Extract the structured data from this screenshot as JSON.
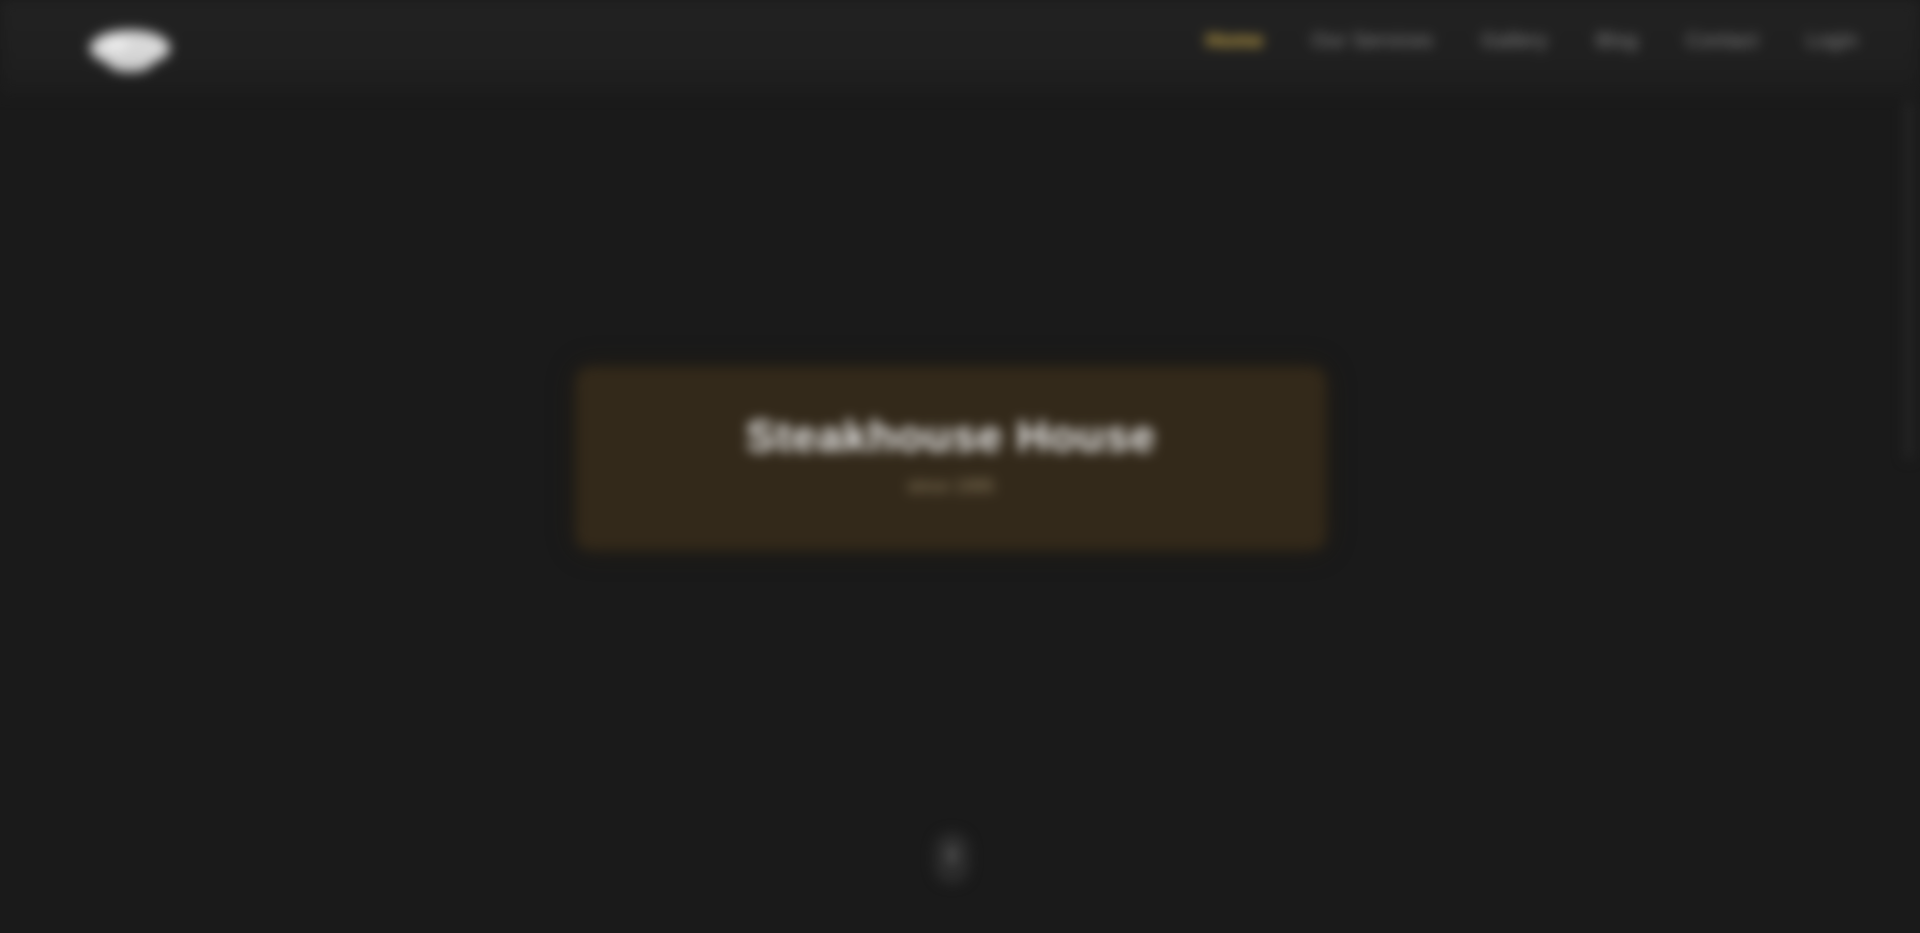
{
  "header": {
    "logo_icon": "brand-logo",
    "nav": [
      {
        "label": "Home",
        "active": true
      },
      {
        "label": "Our Services",
        "active": false
      },
      {
        "label": "Gallery",
        "active": false
      },
      {
        "label": "Blog",
        "active": false
      },
      {
        "label": "Contact",
        "active": false
      },
      {
        "label": "Login",
        "active": false
      }
    ]
  },
  "hero": {
    "title": "Steakhouse House",
    "subtitle": "since 1995"
  },
  "scroll": {
    "icon": "mouse-scroll-icon"
  },
  "colors": {
    "background": "#1a1a1a",
    "accent": "#d6b24a",
    "card": "#33291a"
  }
}
